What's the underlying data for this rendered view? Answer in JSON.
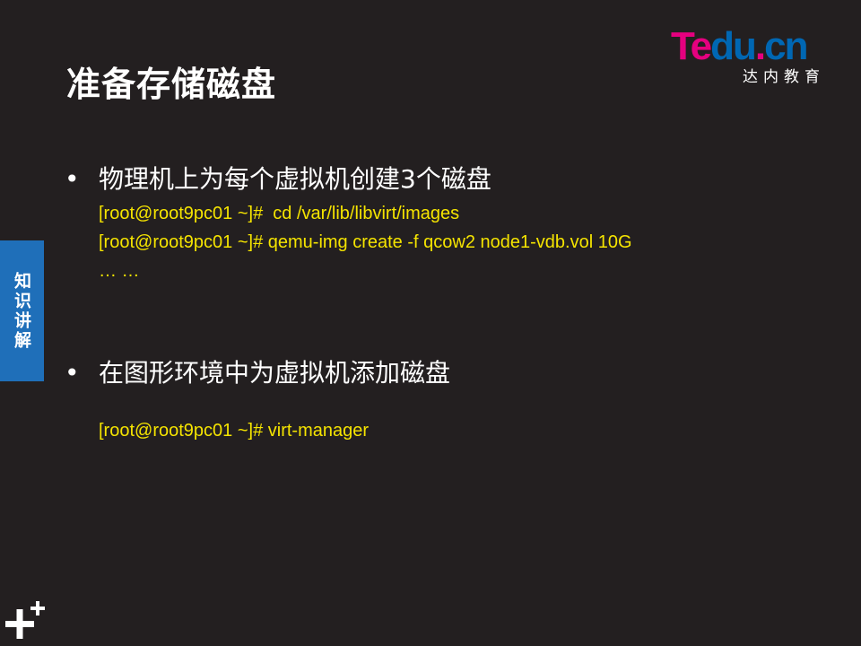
{
  "slide": {
    "title": "准备存储磁盘",
    "logo": {
      "word": "Tedu.cn",
      "subtitle": "达内教育"
    },
    "side_tab": "知识讲解",
    "bullets": [
      {
        "marker": "•",
        "text": "物理机上为每个虚拟机创建3个磁盘",
        "code_lines": [
          "[root@root9pc01 ~]#  cd /var/lib/libvirt/images",
          "[root@root9pc01 ~]# qemu-img create -f qcow2 node1-vdb.vol 10G",
          "… …"
        ]
      },
      {
        "marker": "•",
        "text": "在图形环境中为虚拟机添加磁盘",
        "code_lines": [
          "[root@root9pc01 ~]# virt-manager"
        ]
      }
    ]
  },
  "colors": {
    "background": "#231f20",
    "code_text": "#f5e400",
    "side_tab": "#1f6fb9",
    "logo_magenta": "#e5007f",
    "logo_blue": "#0067b3"
  }
}
